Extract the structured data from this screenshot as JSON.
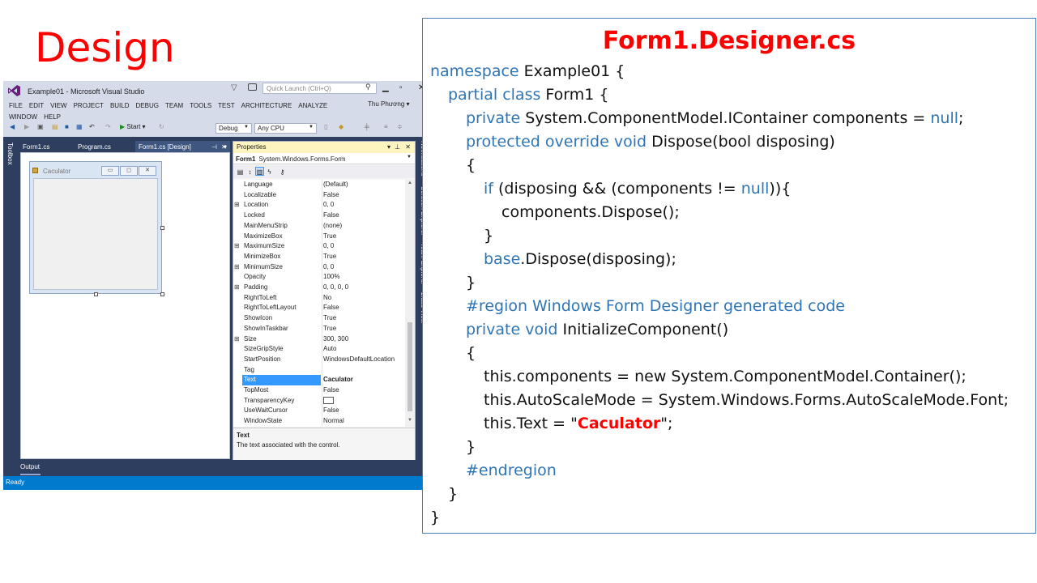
{
  "slide_title": "Design",
  "vs": {
    "window_title": "Example01 - Microsoft Visual Studio",
    "quick_launch_placeholder": "Quick Launch (Ctrl+Q)",
    "menu": [
      "FILE",
      "EDIT",
      "VIEW",
      "PROJECT",
      "BUILD",
      "DEBUG",
      "TEAM",
      "TOOLS",
      "TEST",
      "ARCHITECTURE",
      "ANALYZE",
      "WINDOW",
      "HELP"
    ],
    "user": "Thu Phương",
    "toolbar": {
      "start": "Start",
      "config": "Debug",
      "platform": "Any CPU"
    },
    "toolbox_label": "Toolbox",
    "tabs": [
      "Form1.cs",
      "Program.cs",
      "Form1.cs [Design]"
    ],
    "form_caption": "Caculator",
    "properties": {
      "header": "Properties",
      "object_name": "Form1",
      "object_type": "System.Windows.Forms.Form",
      "rows": [
        {
          "name": "Language",
          "value": "(Default)",
          "expand": ""
        },
        {
          "name": "Localizable",
          "value": "False",
          "expand": ""
        },
        {
          "name": "Location",
          "value": "0, 0",
          "expand": "⊞"
        },
        {
          "name": "Locked",
          "value": "False",
          "expand": ""
        },
        {
          "name": "MainMenuStrip",
          "value": "(none)",
          "expand": ""
        },
        {
          "name": "MaximizeBox",
          "value": "True",
          "expand": ""
        },
        {
          "name": "MaximumSize",
          "value": "0, 0",
          "expand": "⊞"
        },
        {
          "name": "MinimizeBox",
          "value": "True",
          "expand": ""
        },
        {
          "name": "MinimumSize",
          "value": "0, 0",
          "expand": "⊞"
        },
        {
          "name": "Opacity",
          "value": "100%",
          "expand": ""
        },
        {
          "name": "Padding",
          "value": "0, 0, 0, 0",
          "expand": "⊞"
        },
        {
          "name": "RightToLeft",
          "value": "No",
          "expand": ""
        },
        {
          "name": "RightToLeftLayout",
          "value": "False",
          "expand": ""
        },
        {
          "name": "ShowIcon",
          "value": "True",
          "expand": ""
        },
        {
          "name": "ShowInTaskbar",
          "value": "True",
          "expand": ""
        },
        {
          "name": "Size",
          "value": "300, 300",
          "expand": "⊞"
        },
        {
          "name": "SizeGripStyle",
          "value": "Auto",
          "expand": ""
        },
        {
          "name": "StartPosition",
          "value": "WindowsDefaultLocation",
          "expand": ""
        },
        {
          "name": "Tag",
          "value": "",
          "expand": ""
        },
        {
          "name": "Text",
          "value": "Caculator",
          "expand": "",
          "selected": true
        },
        {
          "name": "TopMost",
          "value": "False",
          "expand": ""
        },
        {
          "name": "TransparencyKey",
          "value": "",
          "expand": "",
          "swatch": true
        },
        {
          "name": "UseWaitCursor",
          "value": "False",
          "expand": ""
        },
        {
          "name": "WindowState",
          "value": "Normal",
          "expand": ""
        }
      ],
      "desc_title": "Text",
      "desc_body": "The text associated with the control."
    },
    "right_tabs": [
      "Notifications",
      "Solution Explorer",
      "Team Explorer",
      "Class View"
    ],
    "output_label": "Output",
    "status": "Ready"
  },
  "code_panel": {
    "title": "Form1.Designer.cs",
    "lines": [
      {
        "indent": 0,
        "parts": [
          {
            "t": "namespace",
            "c": "kw"
          },
          {
            "t": " Example01 {"
          }
        ]
      },
      {
        "indent": 1,
        "parts": [
          {
            "t": "partial class",
            "c": "kw"
          },
          {
            "t": " Form1 {"
          }
        ]
      },
      {
        "indent": 2,
        "parts": [
          {
            "t": "private",
            "c": "kw"
          },
          {
            "t": " System.ComponentModel.IContainer components = "
          },
          {
            "t": "null",
            "c": "kw"
          },
          {
            "t": ";"
          }
        ]
      },
      {
        "indent": 2,
        "parts": [
          {
            "t": "protected override void",
            "c": "kw"
          },
          {
            "t": " Dispose(bool disposing)"
          }
        ]
      },
      {
        "indent": 2,
        "parts": [
          {
            "t": "{"
          }
        ]
      },
      {
        "indent": 3,
        "parts": [
          {
            "t": "if",
            "c": "kw"
          },
          {
            "t": " (disposing && (components != "
          },
          {
            "t": "null",
            "c": "kw"
          },
          {
            "t": ")){"
          }
        ]
      },
      {
        "indent": 4,
        "parts": [
          {
            "t": "components.Dispose();"
          }
        ]
      },
      {
        "indent": 3,
        "parts": [
          {
            "t": "}"
          }
        ]
      },
      {
        "indent": 3,
        "parts": [
          {
            "t": "base",
            "c": "kw"
          },
          {
            "t": ".Dispose(disposing);"
          }
        ]
      },
      {
        "indent": 2,
        "parts": [
          {
            "t": "}"
          }
        ]
      },
      {
        "indent": 2,
        "parts": [
          {
            "t": "#region Windows Form Designer generated code",
            "c": "kw"
          }
        ]
      },
      {
        "indent": 2,
        "parts": [
          {
            "t": "private void",
            "c": "kw"
          },
          {
            "t": " InitializeComponent()"
          }
        ]
      },
      {
        "indent": 2,
        "parts": [
          {
            "t": "{"
          }
        ]
      },
      {
        "indent": 3,
        "parts": [
          {
            "t": "this.components = new System.ComponentModel.Container();"
          }
        ]
      },
      {
        "indent": 3,
        "parts": [
          {
            "t": "this.AutoScaleMode = System.Windows.Forms.AutoScaleMode.Font;"
          }
        ]
      },
      {
        "indent": 3,
        "parts": [
          {
            "t": "this.Text = \""
          },
          {
            "t": "Caculator",
            "c": "red"
          },
          {
            "t": "\";"
          }
        ]
      },
      {
        "indent": 2,
        "parts": [
          {
            "t": "}"
          }
        ]
      },
      {
        "indent": 2,
        "parts": [
          {
            "t": "#endregion",
            "c": "kw"
          }
        ]
      },
      {
        "indent": 1,
        "parts": [
          {
            "t": "}"
          }
        ]
      },
      {
        "indent": 0,
        "parts": [
          {
            "t": "}"
          }
        ]
      }
    ]
  },
  "colors": {
    "keyword": "#2e75b6",
    "title_red": "#ff0000",
    "status_blue": "#007acc"
  }
}
